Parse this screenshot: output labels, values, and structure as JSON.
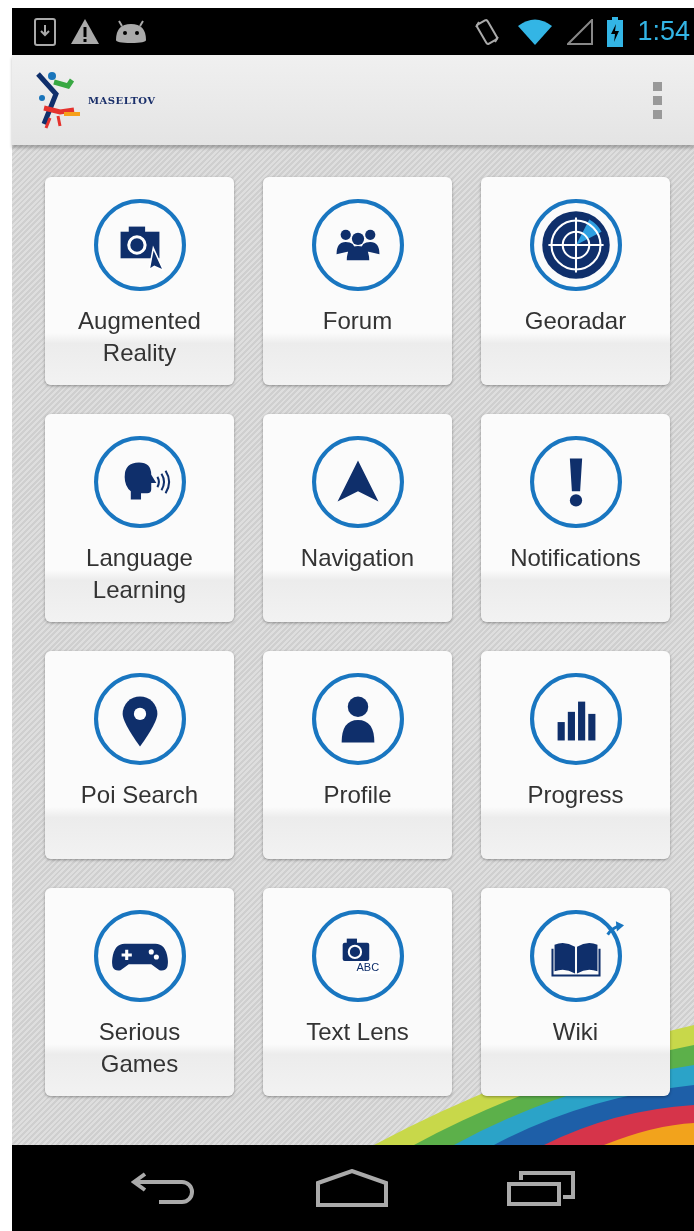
{
  "status_bar": {
    "time": "1:54"
  },
  "app_bar": {
    "logo_text": "MASELTOV"
  },
  "tiles": [
    {
      "label": "Augmented Reality"
    },
    {
      "label": "Forum"
    },
    {
      "label": "Georadar"
    },
    {
      "label": "Language Learning"
    },
    {
      "label": "Navigation"
    },
    {
      "label": "Notifications"
    },
    {
      "label": "Poi Search"
    },
    {
      "label": "Profile"
    },
    {
      "label": "Progress"
    },
    {
      "label": "Serious Games"
    },
    {
      "label": "Text Lens"
    },
    {
      "label": "Wiki"
    }
  ],
  "lens_icon_caption": "ABC"
}
